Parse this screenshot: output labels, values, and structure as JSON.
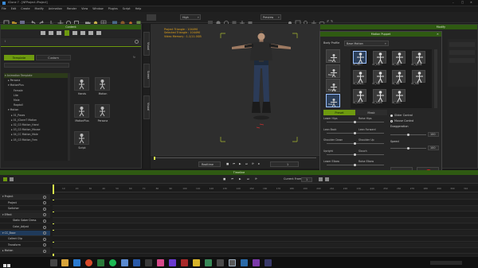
{
  "window": {
    "title": "iClone 7 - [NFProject.iProject]"
  },
  "menu": [
    "File",
    "Edit",
    "Create",
    "Modify",
    "Animation",
    "Render",
    "View",
    "Window",
    "Plugins",
    "Script",
    "Help"
  ],
  "toolbar": {
    "quality": "High",
    "view_mode": "Preview"
  },
  "content": {
    "header": "Content",
    "tabs": [
      "Template",
      "Custom"
    ],
    "tree": [
      "▾ Animation Template",
      "▸ Persona",
      "▾ MotionPlus",
      "Female",
      "Lite",
      "Male",
      "Ragdoll",
      "▾ Motion",
      "▸ 01_Poses",
      "▸ 01_iClone7 Motion",
      "▸ 02_G3 Motion_Hand",
      "▸ 03_G3 Motion_Mouse",
      "▸ 04_CC Motion_Male",
      "▸ 05_G3 Motion_Fem"
    ],
    "tiles": [
      {
        "label": "Hands"
      },
      {
        "label": "Motion"
      },
      {
        "label": "MotionPlus"
      },
      {
        "label": "Persona"
      },
      {
        "label": "Script"
      }
    ]
  },
  "side_tabs": [
    "Visual",
    "Scene",
    "Visual"
  ],
  "viewport": {
    "stats": [
      "Project Triangle : 104490",
      "Selected Triangle : 104490",
      "Video Memory : 1.1/11.0GB"
    ]
  },
  "modify": {
    "header": "Modify"
  },
  "puppet": {
    "header": "Motion Puppet",
    "body_profile_label": "Body Profile",
    "body_profile_value": "Base Motion",
    "thumb_labels": [
      "Idle",
      "Male",
      "Female",
      "Talk",
      "01_Dan...",
      "01_Dan...",
      "01_Dan...",
      "01_Ignore",
      "01_Refere...",
      "01_Talk",
      "01_Talk",
      "01_Talk",
      "01_Drum...",
      "01_Touch",
      "01_Unc..."
    ],
    "tabs": [
      "Preset",
      "Mask"
    ],
    "left_sliders": [
      "Lower Hips",
      "Lean Back",
      "Shoulder Down",
      "Upright",
      "Lower Elbow",
      "Elbow In"
    ],
    "right_sliders": [
      "Raise Hips",
      "Lean Forward",
      "Shoulder Up",
      "Slouch",
      "Raise Elbow",
      "Elbow Out"
    ],
    "radio1": "Slider Control",
    "radio2": "Mouse Control",
    "exaggeration_label": "Exaggeration",
    "exaggeration_value": "100",
    "speed_label": "Speed",
    "speed_value": "100",
    "preview_label": "Preview",
    "record_label": "Record"
  },
  "playbar": {
    "mode": "Realtime",
    "frame": "1"
  },
  "timeline": {
    "header": "Timeline",
    "current_frame_label": "Current Frame",
    "current_frame": "1",
    "rows": [
      "▾ Project",
      "Project",
      "Switcher",
      "▾ Effect",
      "Static Saber Dress",
      "Color_Adjust",
      "▾ CC_Base",
      "Collect Clip",
      "Transform",
      "▸ Motion"
    ],
    "ticks": [
      "10",
      "20",
      "30",
      "40",
      "50",
      "60",
      "70",
      "80",
      "90",
      "100",
      "110",
      "120",
      "130",
      "140",
      "150",
      "160",
      "170",
      "180",
      "190",
      "200",
      "210",
      "220",
      "230",
      "240",
      "250",
      "260",
      "270",
      "280",
      "290",
      "300",
      "310"
    ]
  },
  "colors": {
    "accent_green": "#6e9a10",
    "header_green": "#2f5a12",
    "record_red": "#d81818"
  }
}
